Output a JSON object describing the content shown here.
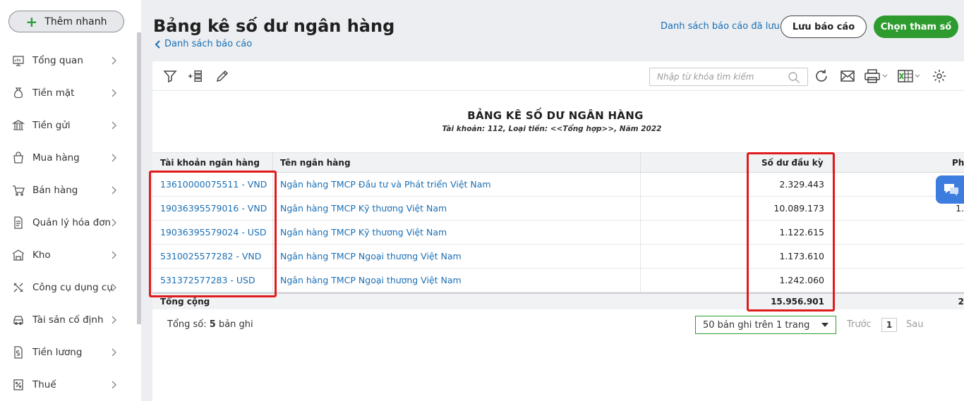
{
  "sidebar": {
    "quick_add": {
      "label": "Thêm nhanh",
      "icon": "plus-icon",
      "color": "#2a9d3b"
    },
    "items": [
      {
        "label": "Tổng quan",
        "icon": "dashboard-icon"
      },
      {
        "label": "Tiền mặt",
        "icon": "money-bag-icon"
      },
      {
        "label": "Tiền gửi",
        "icon": "bank-icon"
      },
      {
        "label": "Mua hàng",
        "icon": "shopping-bag-icon"
      },
      {
        "label": "Bán hàng",
        "icon": "cart-icon"
      },
      {
        "label": "Quản lý hóa đơn",
        "icon": "invoice-icon"
      },
      {
        "label": "Kho",
        "icon": "warehouse-icon"
      },
      {
        "label": "Công cụ dụng cụ",
        "icon": "tools-icon"
      },
      {
        "label": "Tài sản cố định",
        "icon": "car-icon"
      },
      {
        "label": "Tiền lương",
        "icon": "salary-icon"
      },
      {
        "label": "Thuế",
        "icon": "tax-icon"
      }
    ]
  },
  "header": {
    "title": "Bảng kê số dư ngân hàng",
    "back_link": "Danh sách báo cáo",
    "saved_reports_link": "Danh sách báo cáo đã lưu",
    "save_button": "Lưu báo cáo",
    "params_button": "Chọn tham số",
    "accent": "#2e9b2f"
  },
  "toolbar": {
    "search_placeholder": "Nhập từ khóa tìm kiếm",
    "icons": [
      "filter-icon",
      "add-column-icon",
      "edit-icon",
      "refresh-icon",
      "email-icon",
      "print-icon",
      "excel-icon",
      "settings-icon"
    ]
  },
  "report": {
    "title": "BẢNG KÊ SỐ DƯ NGÂN HÀNG",
    "subtitle": "Tài khoản: 112, Loại tiền: <<Tổng hợp>>, Năm 2022",
    "columns": [
      "Tài khoản ngân hàng",
      "Tên ngân hàng",
      "Số dư đầu kỳ",
      "Ph"
    ],
    "rows": [
      {
        "account": "13610000075511 - VND",
        "bank": "Ngân hàng TMCP Đầu tư và Phát triển Việt Nam",
        "opening": "2.329.443",
        "next": ""
      },
      {
        "account": "19036395579016 - VND",
        "bank": "Ngân hàng TMCP Kỹ thương Việt Nam",
        "opening": "10.089.173",
        "next": "1."
      },
      {
        "account": "19036395579024 - USD",
        "bank": "Ngân hàng TMCP Kỹ thương Việt Nam",
        "opening": "1.122.615",
        "next": ""
      },
      {
        "account": "5310025577282 - VND",
        "bank": "Ngân hàng TMCP Ngoại thương Việt Nam",
        "opening": "1.173.610",
        "next": ""
      },
      {
        "account": "531372577283 - USD",
        "bank": "Ngân hàng TMCP Ngoại thương Việt Nam",
        "opening": "1.242.060",
        "next": ""
      }
    ],
    "total_label": "Tổng cộng",
    "total_opening": "15.956.901",
    "total_next": "2"
  },
  "footer": {
    "count_prefix": "Tổng số:",
    "count_value": "5",
    "count_suffix": "bản ghi",
    "page_size": "50 bản ghi trên 1 trang",
    "prev": "Trước",
    "page": "1",
    "next": "Sau"
  },
  "highlight_color": "#e01b1b"
}
